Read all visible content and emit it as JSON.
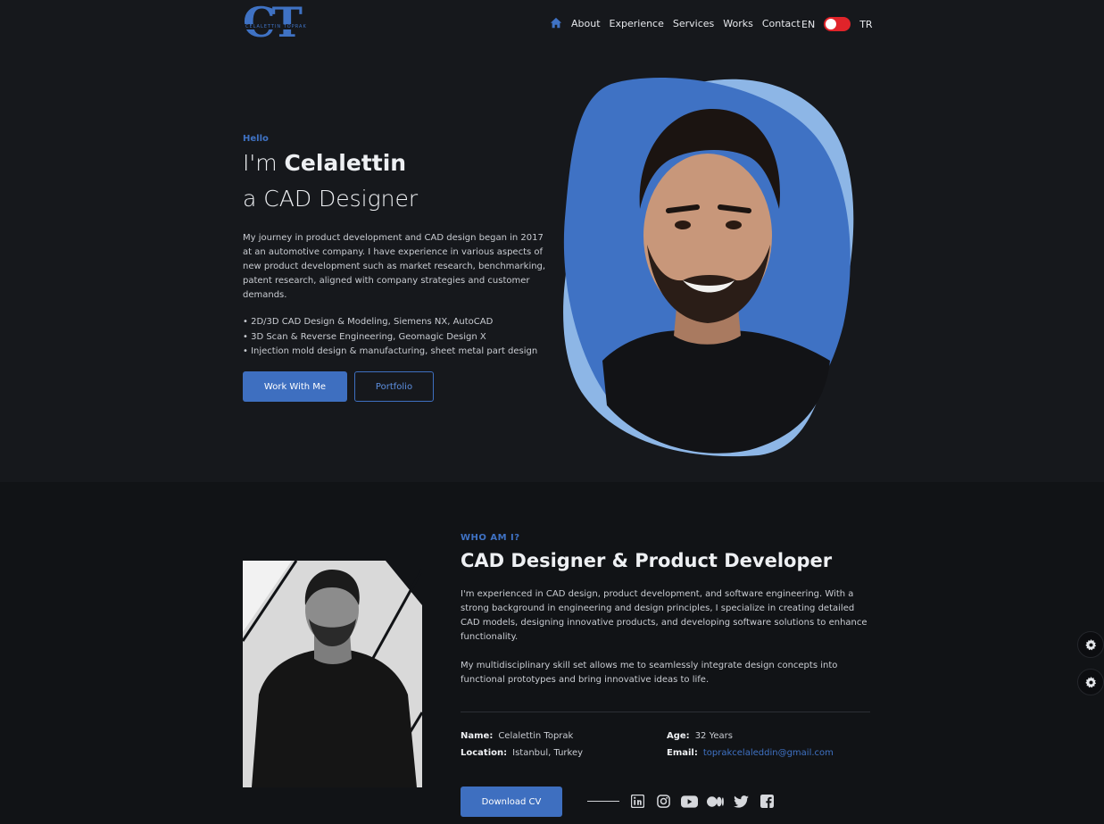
{
  "nav": {
    "logo_mark": "CT",
    "logo_sub": "CELALETTIN TOPRAK",
    "links": [
      "About",
      "Experience",
      "Services",
      "Works",
      "Contact"
    ],
    "lang_left": "EN",
    "lang_right": "TR"
  },
  "hero": {
    "hello": "Hello",
    "line1_prefix": "I'm ",
    "line1_name": "Celalettin",
    "line2": "a CAD Designer",
    "description": "My journey in product development and CAD design began in 2017 at an automotive company. I have experience in various aspects of new product development such as market research, benchmarking, patent research, aligned with company strategies and customer demands.",
    "bullets": [
      "• 2D/3D CAD Design & Modeling, Siemens NX, AutoCAD",
      "• 3D Scan & Reverse Engineering, Geomagic Design X",
      "• Injection mold design & manufacturing, sheet metal part design"
    ],
    "primary_button": "Work With Me",
    "secondary_button": "Portfolio"
  },
  "about": {
    "eyebrow": "WHO AM I?",
    "title": "CAD Designer & Product Developer",
    "paragraph1": "I'm experienced in CAD design, product development, and software engineering. With a strong background in engineering and design principles, I specialize in creating detailed CAD models, designing innovative products, and developing software solutions to enhance functionality.",
    "paragraph2": "My multidisciplinary skill set allows me to seamlessly integrate design concepts into functional prototypes and bring innovative ideas to life.",
    "name_label": "Name:",
    "name_value": "Celalettin Toprak",
    "location_label": "Location:",
    "location_value": "Istanbul, Turkey",
    "age_label": "Age:",
    "age_value": "32 Years",
    "email_label": "Email:",
    "email_value": "toprakcelaleddin@gmail.com",
    "cv_button": "Download CV"
  },
  "socials": [
    "linkedin-icon",
    "instagram-icon",
    "youtube-icon",
    "medium-icon",
    "twitter-icon",
    "facebook-icon"
  ],
  "colors": {
    "accent": "#3e6fc0",
    "blob_dark": "#3f72c4",
    "blob_light": "#8db6e6",
    "toggle": "#e0242a",
    "background": "#16181c"
  }
}
